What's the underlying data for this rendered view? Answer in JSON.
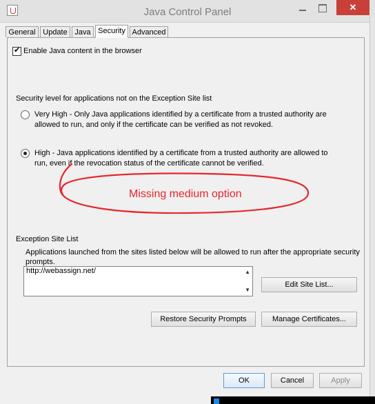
{
  "window": {
    "title": "Java Control Panel",
    "close_glyph": "✕"
  },
  "tabs": [
    {
      "label": "General"
    },
    {
      "label": "Update"
    },
    {
      "label": "Java"
    },
    {
      "label": "Security"
    },
    {
      "label": "Advanced"
    }
  ],
  "security": {
    "enable_java_label": "Enable Java content in the browser",
    "enable_java_checked": true,
    "level_heading": "Security level for applications not on the Exception Site list",
    "options": [
      {
        "label": "Very High - Only Java applications identified by a certificate from a trusted authority are allowed to run, and only if the certificate can be verified as not revoked.",
        "selected": false
      },
      {
        "label": "High - Java applications identified by a certificate from a trusted authority are allowed to run, even if the revocation status of the certificate cannot be verified.",
        "selected": true
      }
    ],
    "annotation": "Missing medium option",
    "annotation_color": "#e8252b"
  },
  "exception": {
    "title": "Exception Site List",
    "description": "Applications launched from the sites listed below will be allowed to run after the appropriate security prompts.",
    "sites": [
      "http://webassign.net/"
    ],
    "edit_button": "Edit Site List...",
    "restore_button": "Restore Security Prompts",
    "certificates_button": "Manage Certificates..."
  },
  "footer": {
    "ok": "OK",
    "cancel": "Cancel",
    "apply": "Apply"
  }
}
